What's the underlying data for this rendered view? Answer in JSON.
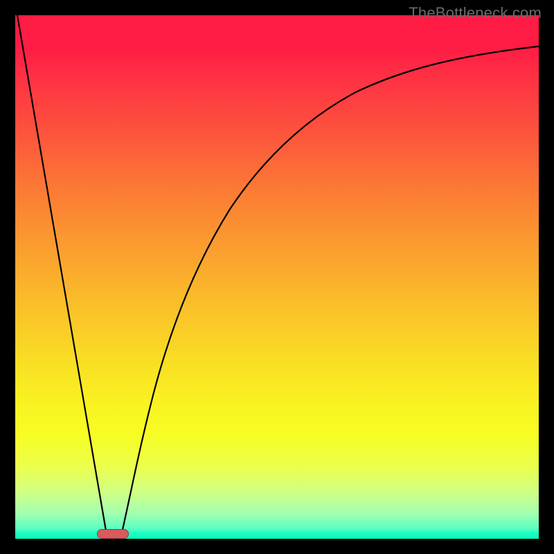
{
  "watermark": "TheBottleneck.com",
  "colors": {
    "frame": "#000000",
    "watermark": "#6a6a6a",
    "pill_fill": "#d85b5e",
    "pill_border": "#9c3c3f",
    "curve": "#000000",
    "gradient_top": "#fe1b44",
    "gradient_bottom": "#09fac0"
  },
  "chart_data": {
    "type": "line",
    "title": "",
    "xlabel": "",
    "ylabel": "",
    "xlim": [
      0,
      100
    ],
    "ylim": [
      0,
      100
    ],
    "series": [
      {
        "name": "left-line",
        "x": [
          0,
          17.5
        ],
        "values": [
          100,
          0
        ]
      },
      {
        "name": "right-curve",
        "x": [
          20,
          23,
          27,
          32,
          38,
          45,
          53,
          62,
          72,
          83,
          95,
          100
        ],
        "values": [
          0,
          13,
          27,
          41,
          54,
          65,
          74,
          81,
          86.5,
          90.5,
          93.2,
          94
        ]
      }
    ],
    "marker": {
      "name": "bottleneck-pill",
      "x": 18.5,
      "y": 0,
      "width_pct": 5.8,
      "height_pct": 1.6
    }
  }
}
